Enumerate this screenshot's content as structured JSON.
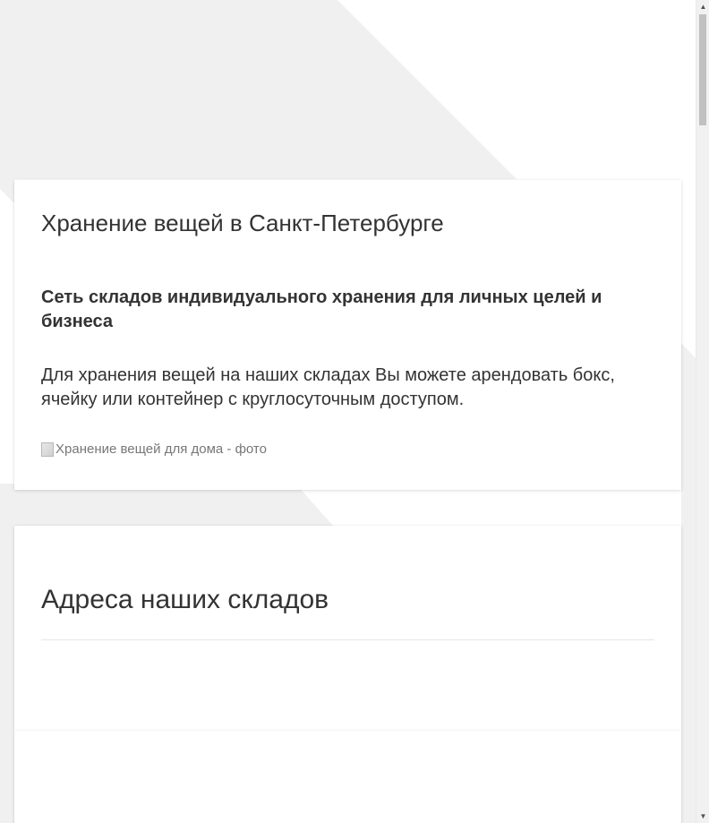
{
  "hero": {
    "title": "Хранение вещей в Санкт-Петербурге",
    "subtitle": "Сеть складов индивидуального хранения для личных целей и бизнеса",
    "text": "Для хранения вещей на наших складах Вы можете арендовать бокс, ячейку или контейнер с круглосуточным доступом.",
    "image_alt": "Хранение вещей для дома - фото"
  },
  "addresses": {
    "title": "Адреса наших складов"
  },
  "scrollbar": {
    "up_arrow": "▲",
    "down_arrow": "▼"
  },
  "colors": {
    "background_pattern": "#f0f0f0",
    "text": "#333333",
    "card": "#ffffff"
  }
}
